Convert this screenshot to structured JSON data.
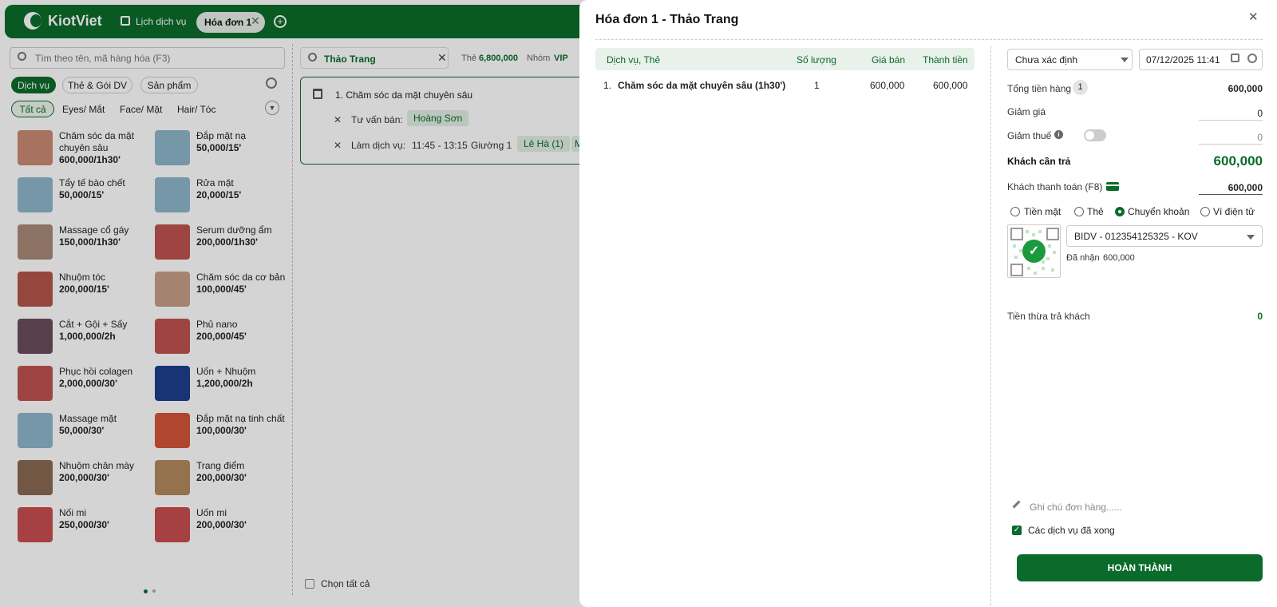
{
  "topbar": {
    "logo": "KiotViet",
    "nav_schedule": "Lịch dịch vụ",
    "active_tab": "Hóa đơn 1",
    "tab_close": "✕",
    "add_tab": "+"
  },
  "left": {
    "search_placeholder": "Tìm theo tên, mã hàng hóa (F3)",
    "category_tabs": [
      "Dịch vụ",
      "Thẻ & Gói DV",
      "Sản phẩm"
    ],
    "filters": [
      "Tất cả",
      "Eyes/ Mắt",
      "Face/ Mặt",
      "Hair/ Tóc"
    ],
    "items": [
      {
        "name": "Chăm sóc da mặt chuyên sâu",
        "price": "600,000/1h30'",
        "color": "#c98a73"
      },
      {
        "name": "Đắp mặt nạ",
        "price": "50,000/15'",
        "color": "#8fb6c9"
      },
      {
        "name": "Tẩy tế bào chết",
        "price": "50,000/15'",
        "color": "#8fb6c9"
      },
      {
        "name": "Rửa mặt",
        "price": "20,000/15'",
        "color": "#8fb6c9"
      },
      {
        "name": "Massage cổ gáy",
        "price": "150,000/1h30'",
        "color": "#a88a76"
      },
      {
        "name": "Serum dưỡng ẩm",
        "price": "200,000/1h30'",
        "color": "#c0544f"
      },
      {
        "name": "Nhuộm tóc",
        "price": "200,000/15'",
        "color": "#b5564a"
      },
      {
        "name": "Chăm sóc da cơ bản",
        "price": "100,000/45'",
        "color": "#c79e88"
      },
      {
        "name": "Cắt + Gội + Sấy",
        "price": "1,000,000/2h",
        "color": "#6a4d5a"
      },
      {
        "name": "Phủ nano",
        "price": "200,000/45'",
        "color": "#c0544f"
      },
      {
        "name": "Phục hồi colagen",
        "price": "2,000,000/30'",
        "color": "#c0544f"
      },
      {
        "name": "Uốn + Nhuộm",
        "price": "1,200,000/2h",
        "color": "#1d3e8f"
      },
      {
        "name": "Massage mặt",
        "price": "50,000/30'",
        "color": "#8fb6c9"
      },
      {
        "name": "Đắp mặt nạ tinh chất",
        "price": "100,000/30'",
        "color": "#d4553a"
      },
      {
        "name": "Nhuộm chân mày",
        "price": "200,000/30'",
        "color": "#8a6a52"
      },
      {
        "name": "Trang điểm",
        "price": "200,000/30'",
        "color": "#b38a5e"
      },
      {
        "name": "Nối mi",
        "price": "250,000/30'",
        "color": "#c94f4f"
      },
      {
        "name": "Uốn mi",
        "price": "200,000/30'",
        "color": "#c94f4f"
      }
    ]
  },
  "middle": {
    "customer_name": "Thảo Trang",
    "card_label": "Thẻ",
    "card_value": "6,800,000",
    "group_label": "Nhóm",
    "group_value": "VIP",
    "service_line": "1.   Chăm sóc da mặt chuyên sâu",
    "advisor_label": "Tư vấn bán:",
    "advisor": "Hoàng Sơn",
    "do_label": "Làm dịch vụ:",
    "time": "11:45 - 13:15",
    "bed": "Giường 1",
    "staff": "Lê Hà (1)",
    "staff_more": "M",
    "select_all": "Chọn tất cả"
  },
  "modal": {
    "title": "Hóa đơn 1 - Thảo Trang",
    "close": "✕",
    "table": {
      "headers": [
        "Dịch vụ, Thẻ",
        "Số lượng",
        "Giá bán",
        "Thành tiền"
      ],
      "rows": [
        {
          "index": "1.",
          "name": "Chăm sóc da mặt chuyên sâu (1h30')",
          "qty": "1",
          "price": "600,000",
          "total": "600,000"
        }
      ]
    },
    "status": "Chưa xác định",
    "date": "07/12/2025 11:41",
    "subtotal_label": "Tổng tiền hàng",
    "subtotal_qty": "1",
    "subtotal": "600,000",
    "discount_label": "Giảm giá",
    "discount": "0",
    "tax_label": "Giảm thuế",
    "tax": "0",
    "due_label": "Khách cần trả",
    "due": "600,000",
    "paid_label": "Khách thanh toán (F8)",
    "paid": "600,000",
    "methods": [
      "Tiền mặt",
      "Thẻ",
      "Chuyển khoản",
      "Ví điện tử"
    ],
    "selected_method": "Chuyển khoản",
    "bank_account": "BIDV - 012354125325 - KOV",
    "received_label": "Đã nhận",
    "received": "600,000",
    "change_label": "Tiền thừa trả khách",
    "change": "0",
    "note_placeholder": "Ghi chú đơn hàng......",
    "services_done_label": "Các dịch vụ đã xong",
    "finish_button": "HOÀN THÀNH"
  },
  "colors": {
    "brand": "#0b6b2b",
    "success": "#1b9a3e"
  }
}
